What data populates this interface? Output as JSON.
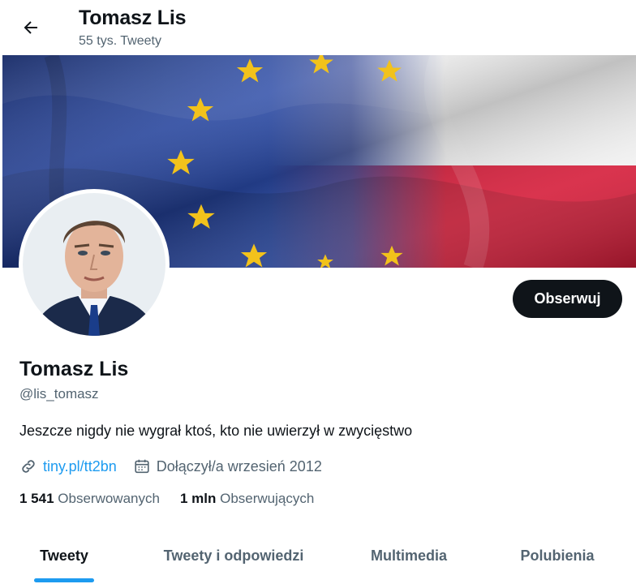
{
  "header": {
    "name": "Tomasz Lis",
    "tweet_count": "55 tys. Tweety"
  },
  "profile": {
    "name": "Tomasz Lis",
    "handle": "@lis_tomasz",
    "bio": "Jeszcze nigdy nie wygrał ktoś, kto nie uwierzył w zwycięstwo",
    "link": "tiny.pl/tt2bn",
    "joined": "Dołączył/a wrzesień 2012",
    "follow_label": "Obserwuj"
  },
  "stats": {
    "following_count": "1 541",
    "following_label": "Obserwowanych",
    "followers_count": "1 mln",
    "followers_label": "Obserwujących"
  },
  "tabs": [
    {
      "label": "Tweety",
      "active": true
    },
    {
      "label": "Tweety i odpowiedzi",
      "active": false
    },
    {
      "label": "Multimedia",
      "active": false
    },
    {
      "label": "Polubienia",
      "active": false
    }
  ],
  "colors": {
    "accent": "#1d9bf0",
    "text_primary": "#0f1419",
    "text_secondary": "#536471",
    "eu_blue": "#1e3d8f",
    "eu_star": "#f2c21b",
    "pl_red": "#d51d3a",
    "pl_white": "#f4f4f4"
  },
  "icons": {
    "back": "arrow-left-icon",
    "link": "link-icon",
    "calendar": "calendar-icon"
  }
}
